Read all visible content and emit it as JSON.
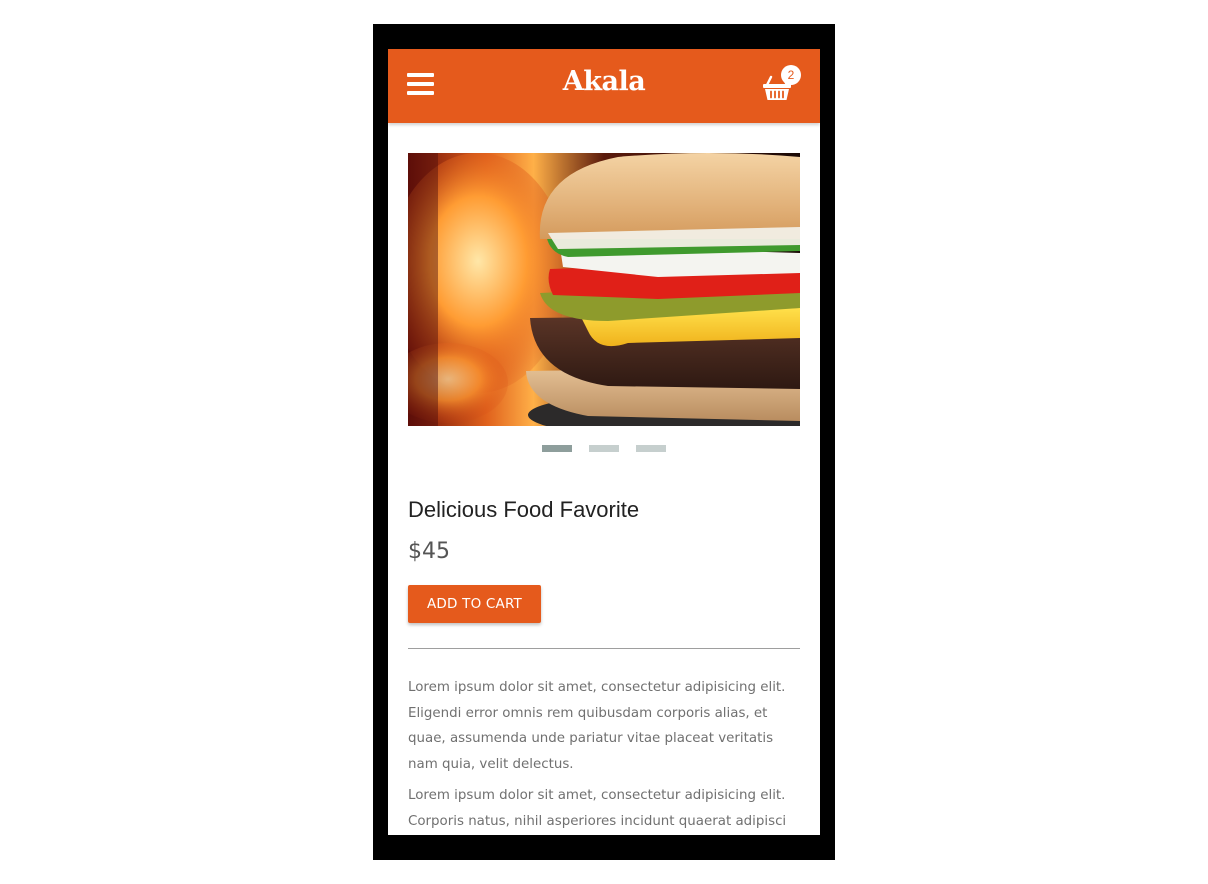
{
  "colors": {
    "accent": "#e55a1c",
    "frame": "#000000",
    "dot_active": "#8e9e9c",
    "dot_inactive": "#c6cfce"
  },
  "header": {
    "menu_icon": "hamburger-menu-icon",
    "brand": "Akala",
    "cart_icon": "shopping-basket-icon",
    "cart_count": "2"
  },
  "carousel": {
    "image": "burger-photo",
    "slide_count": 3,
    "active_index": 0
  },
  "product": {
    "title": "Delicious Food Favorite",
    "price": "$45",
    "add_to_cart_label": "ADD TO CART"
  },
  "description": [
    "Lorem ipsum dolor sit amet, consectetur adipisicing elit. Eligendi error omnis rem quibusdam corporis alias, et quae, assumenda unde pariatur vitae placeat veritatis nam quia, velit delectus.",
    "Lorem ipsum dolor sit amet, consectetur adipisicing elit. Corporis natus, nihil asperiores incidunt quaerat adipisci expedita quae mollitia quibusdam sapiente"
  ]
}
